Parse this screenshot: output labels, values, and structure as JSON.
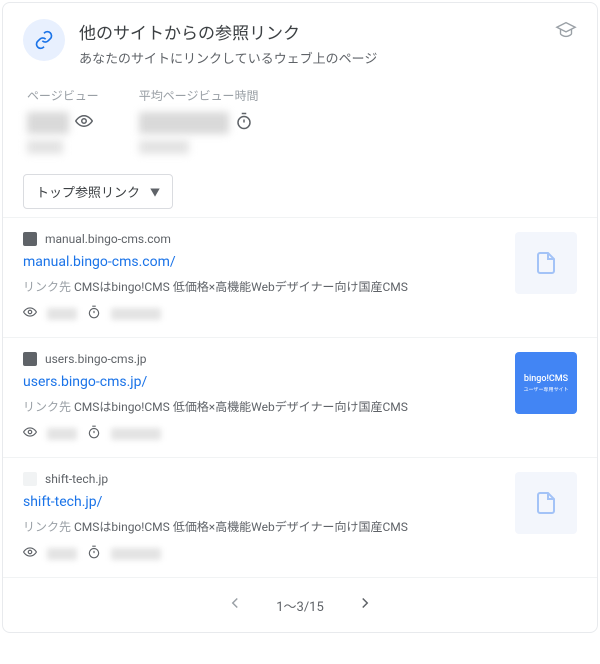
{
  "header": {
    "title": "他のサイトからの参照リンク",
    "subtitle": "あなたのサイトにリンクしているウェブ上のページ"
  },
  "metrics": {
    "pageviews_label": "ページビュー",
    "avgtime_label": "平均ページビュー時間"
  },
  "dropdown": {
    "label": "トップ参照リンク"
  },
  "rows": [
    {
      "host": "manual.bingo-cms.com",
      "link": "manual.bingo-cms.com/",
      "desc_label": "リンク先",
      "desc": "CMSはbingo!CMS 低価格×高機能Webデザイナー向け国産CMS",
      "thumb_type": "doc"
    },
    {
      "host": "users.bingo-cms.jp",
      "link": "users.bingo-cms.jp/",
      "desc_label": "リンク先",
      "desc": "CMSはbingo!CMS 低価格×高機能Webデザイナー向け国産CMS",
      "thumb_type": "blue",
      "thumb_text": "bingo!CMS",
      "thumb_sub": "ユーザー専用サイト"
    },
    {
      "host": "shift-tech.jp",
      "link": "shift-tech.jp/",
      "desc_label": "リンク先",
      "desc": "CMSはbingo!CMS 低価格×高機能Webデザイナー向け国産CMS",
      "thumb_type": "doc"
    }
  ],
  "pager": {
    "range": "1～3/15"
  }
}
